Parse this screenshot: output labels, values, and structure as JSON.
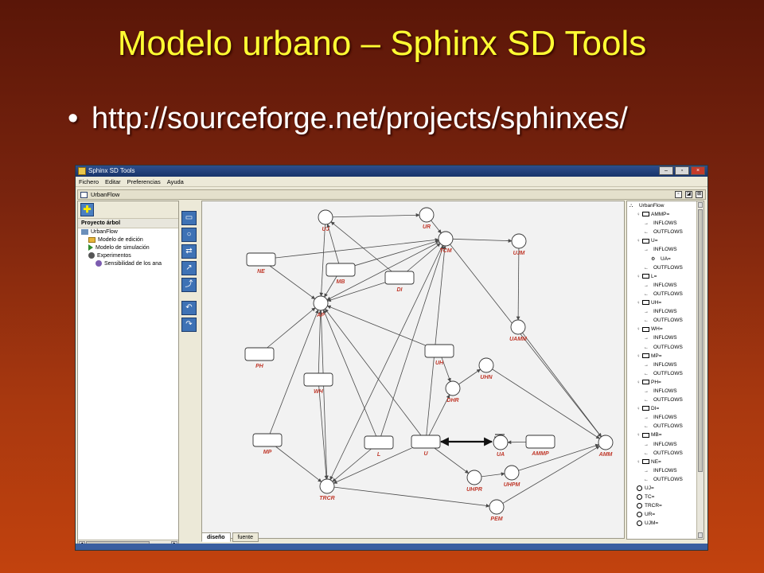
{
  "slide": {
    "title": "Modelo urbano – Sphinx SD Tools",
    "bullet": "http://sourceforge.net/projects/sphinxes/"
  },
  "window": {
    "title": "Sphinx SD Tools",
    "buttons": [
      "–",
      "▫",
      "×"
    ]
  },
  "menu": {
    "items": [
      "Fichero",
      "Editar",
      "Preferencias",
      "Ayuda"
    ]
  },
  "internal_frame": {
    "title": "UrbanFlow",
    "buttons": [
      "▫",
      "◪",
      "⊠"
    ]
  },
  "project_tree": {
    "header": "Proyecto árbol",
    "items": [
      {
        "label": "UrbanFlow",
        "icon": "root-icon",
        "indent": 0
      },
      {
        "label": "Modelo de edición",
        "icon": "folder-icon",
        "indent": 1
      },
      {
        "label": "Modelo de simulación",
        "icon": "play-icon",
        "indent": 1
      },
      {
        "label": "Experimentos",
        "icon": "experiments-icon",
        "indent": 1
      },
      {
        "label": "Sensibilidad de los ana",
        "icon": "sensitivity-icon",
        "indent": 2
      }
    ]
  },
  "tabs": [
    "diseño",
    "fuente"
  ],
  "diagram": {
    "nodes": [
      {
        "id": "UJ",
        "label": "UJ",
        "shape": "circle"
      },
      {
        "id": "UR",
        "label": "UR",
        "shape": "circle"
      },
      {
        "id": "TCM",
        "label": "TCM",
        "shape": "circle"
      },
      {
        "id": "UJM",
        "label": "UJM",
        "shape": "circle"
      },
      {
        "id": "NE",
        "label": "NE",
        "shape": "rect"
      },
      {
        "id": "MB",
        "label": "MB",
        "shape": "rect"
      },
      {
        "id": "DI",
        "label": "DI",
        "shape": "rect"
      },
      {
        "id": "AP",
        "label": "AP",
        "shape": "circle"
      },
      {
        "id": "UAMM",
        "label": "UAMM",
        "shape": "circle"
      },
      {
        "id": "PH",
        "label": "PH",
        "shape": "rect"
      },
      {
        "id": "UH",
        "label": "UH",
        "shape": "rect"
      },
      {
        "id": "UHN",
        "label": "UHN",
        "shape": "circle"
      },
      {
        "id": "WH",
        "label": "WH",
        "shape": "rect"
      },
      {
        "id": "DHR",
        "label": "DHR",
        "shape": "circle"
      },
      {
        "id": "MP",
        "label": "MP",
        "shape": "rect"
      },
      {
        "id": "L",
        "label": "L",
        "shape": "rect"
      },
      {
        "id": "U",
        "label": "U",
        "shape": "rect"
      },
      {
        "id": "UA",
        "label": "UA",
        "shape": "circle"
      },
      {
        "id": "AMMP",
        "label": "AMMP",
        "shape": "rect"
      },
      {
        "id": "AMM",
        "label": "AMM",
        "shape": "circle"
      },
      {
        "id": "UHPR",
        "label": "UHPR",
        "shape": "circle"
      },
      {
        "id": "UHPM",
        "label": "UHPM",
        "shape": "circle"
      },
      {
        "id": "TRCR",
        "label": "TRCR",
        "shape": "circle"
      },
      {
        "id": "PEM",
        "label": "PEM",
        "shape": "circle"
      }
    ],
    "edges": [
      [
        "UJ",
        "UR"
      ],
      [
        "UR",
        "TCM"
      ],
      [
        "TCM",
        "UJM"
      ],
      [
        "UJM",
        "UAMM"
      ],
      [
        "UAMM",
        "AMM"
      ],
      [
        "NE",
        "TCM"
      ],
      [
        "MB",
        "TCM"
      ],
      [
        "DI",
        "TCM"
      ],
      [
        "MB",
        "UJ"
      ],
      [
        "DI",
        "UJ"
      ],
      [
        "NE",
        "AP"
      ],
      [
        "MB",
        "AP"
      ],
      [
        "DI",
        "AP"
      ],
      [
        "TCM",
        "AP"
      ],
      [
        "UH",
        "AP"
      ],
      [
        "PH",
        "AP"
      ],
      [
        "WH",
        "AP"
      ],
      [
        "MP",
        "AP"
      ],
      [
        "L",
        "AP"
      ],
      [
        "U",
        "AP"
      ],
      [
        "UJ",
        "AP"
      ],
      [
        "AP",
        "TRCR"
      ],
      [
        "U",
        "TCM"
      ],
      [
        "L",
        "TCM"
      ],
      [
        "UH",
        "DHR"
      ],
      [
        "DHR",
        "UHN"
      ],
      [
        "UHN",
        "AMM"
      ],
      [
        "U",
        "DHR"
      ],
      [
        "AMMP",
        "UA"
      ],
      [
        "U",
        "UHPR"
      ],
      [
        "UHPR",
        "UHPM"
      ],
      [
        "UHPM",
        "AMM"
      ],
      [
        "MP",
        "TRCR"
      ],
      [
        "L",
        "TRCR"
      ],
      [
        "U",
        "TRCR"
      ],
      [
        "WH",
        "TRCR"
      ],
      [
        "TRCR",
        "PEM"
      ],
      [
        "PEM",
        "AMM"
      ],
      [
        "TCM",
        "TRCR"
      ],
      [
        "TCM",
        "AMM"
      ]
    ]
  },
  "structure_tree": {
    "items": [
      {
        "label": "UrbanFlow",
        "kind": "root",
        "indent": 0
      },
      {
        "label": "AMMP=",
        "kind": "box",
        "indent": 1
      },
      {
        "label": "INFLOWS",
        "kind": "in",
        "indent": 2
      },
      {
        "label": "OUTFLOWS",
        "kind": "out",
        "indent": 2
      },
      {
        "label": "U=",
        "kind": "box",
        "indent": 1
      },
      {
        "label": "INFLOWS",
        "kind": "in",
        "indent": 2
      },
      {
        "label": "UA=",
        "kind": "flow",
        "indent": 3
      },
      {
        "label": "OUTFLOWS",
        "kind": "out",
        "indent": 2
      },
      {
        "label": "L=",
        "kind": "box",
        "indent": 1
      },
      {
        "label": "INFLOWS",
        "kind": "in",
        "indent": 2
      },
      {
        "label": "OUTFLOWS",
        "kind": "out",
        "indent": 2
      },
      {
        "label": "UH=",
        "kind": "box",
        "indent": 1
      },
      {
        "label": "INFLOWS",
        "kind": "in",
        "indent": 2
      },
      {
        "label": "OUTFLOWS",
        "kind": "out",
        "indent": 2
      },
      {
        "label": "WH=",
        "kind": "box",
        "indent": 1
      },
      {
        "label": "INFLOWS",
        "kind": "in",
        "indent": 2
      },
      {
        "label": "OUTFLOWS",
        "kind": "out",
        "indent": 2
      },
      {
        "label": "MP=",
        "kind": "box",
        "indent": 1
      },
      {
        "label": "INFLOWS",
        "kind": "in",
        "indent": 2
      },
      {
        "label": "OUTFLOWS",
        "kind": "out",
        "indent": 2
      },
      {
        "label": "PH=",
        "kind": "box",
        "indent": 1
      },
      {
        "label": "INFLOWS",
        "kind": "in",
        "indent": 2
      },
      {
        "label": "OUTFLOWS",
        "kind": "out",
        "indent": 2
      },
      {
        "label": "DI=",
        "kind": "box",
        "indent": 1
      },
      {
        "label": "INFLOWS",
        "kind": "in",
        "indent": 2
      },
      {
        "label": "OUTFLOWS",
        "kind": "out",
        "indent": 2
      },
      {
        "label": "MB=",
        "kind": "box",
        "indent": 1
      },
      {
        "label": "INFLOWS",
        "kind": "in",
        "indent": 2
      },
      {
        "label": "OUTFLOWS",
        "kind": "out",
        "indent": 2
      },
      {
        "label": "NE=",
        "kind": "box",
        "indent": 1
      },
      {
        "label": "INFLOWS",
        "kind": "in",
        "indent": 2
      },
      {
        "label": "OUTFLOWS",
        "kind": "out",
        "indent": 2
      },
      {
        "label": "UJ=",
        "kind": "circle",
        "indent": 1
      },
      {
        "label": "TC=",
        "kind": "circle",
        "indent": 1
      },
      {
        "label": "TRCR=",
        "kind": "circle",
        "indent": 1
      },
      {
        "label": "UR=",
        "kind": "circle",
        "indent": 1
      },
      {
        "label": "UJM=",
        "kind": "circle",
        "indent": 1
      }
    ]
  },
  "colors": {
    "title": "#ffff33",
    "bullet": "#ffffff",
    "node_label": "#c0392b",
    "edge": "#4a4a4a"
  }
}
